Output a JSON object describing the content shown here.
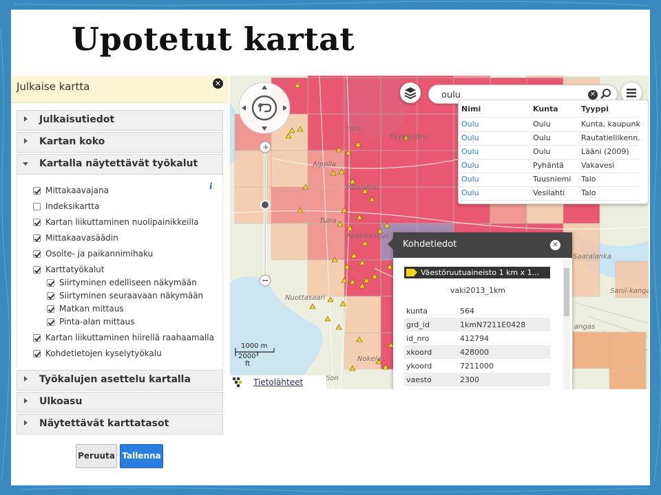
{
  "slide": {
    "title": "Upotetut kartat"
  },
  "panel": {
    "title": "Julkaise kartta",
    "sections": {
      "publication": "Julkaisutiedot",
      "map_size": "Kartan koko",
      "tools": "Kartalla näytettävät työkalut",
      "tool_layout": "Työkalujen asettelu kartalla",
      "appearance": "Ulkoasu",
      "layers": "Näytettävät karttatasot"
    },
    "tools": [
      {
        "label": "Mittakaavajana",
        "checked": true
      },
      {
        "label": "Indeksikartta",
        "checked": false
      },
      {
        "label": "Kartan liikuttaminen nuolipainikkeilla",
        "checked": true
      },
      {
        "label": "Mittakaavasäädin",
        "checked": true
      },
      {
        "label": "Osoite- ja paikannimihaku",
        "checked": true
      },
      {
        "label": "Karttatyökalut",
        "checked": true
      },
      {
        "label": "Siirtyminen edelliseen näkymään",
        "checked": true
      },
      {
        "label": "Siirtyminen seuraavaan näkymään",
        "checked": true
      },
      {
        "label": "Matkan mittaus",
        "checked": true
      },
      {
        "label": "Pinta-alan mittaus",
        "checked": true
      },
      {
        "label": "Kartan liikuttaminen hiirellä raahaamalla",
        "checked": true
      },
      {
        "label": "Kohdetietojen kyselytyökalu",
        "checked": true
      }
    ],
    "info_icon": "i",
    "cancel": "Peruuta",
    "save": "Tallenna"
  },
  "search": {
    "value": "oulu",
    "clear_icon": "close-icon",
    "search_icon": "search-icon"
  },
  "results": {
    "headers": [
      "Nimi",
      "Kunta",
      "Tyyppi"
    ],
    "rows": [
      [
        "Oulu",
        "Oulu",
        "Kunta, kaupunki"
      ],
      [
        "Oulu",
        "Oulu",
        "Rautatieliikenn..."
      ],
      [
        "Oulu",
        "Oulu",
        "Lääni (2009)"
      ],
      [
        "Oulu",
        "Pyhäntä",
        "Vakavesi"
      ],
      [
        "Oulu",
        "Tuusniemi",
        "Talo"
      ],
      [
        "Oulu",
        "Vesilahti",
        "Talo"
      ]
    ]
  },
  "info": {
    "title": "Kohdetiedot",
    "layer": "Väestöruutuaineisto 1 km x 1...",
    "subtitle": "vaki2013_1km",
    "rows": [
      [
        "kunta",
        "564"
      ],
      [
        "grd_id",
        "1kmN7211E0428"
      ],
      [
        "id_nro",
        "412794"
      ],
      [
        "xkoord",
        "428000"
      ],
      [
        "ykoord",
        "7211000"
      ],
      [
        "vaesto",
        "2300"
      ]
    ]
  },
  "map": {
    "scale_metric": "1000 m",
    "scale_imperial_value": "2000",
    "scale_imperial_unit": "ft",
    "attribution": "Tietolähteet",
    "place_labels": [
      "Isko",
      "Pyykösjärvi",
      "Alppila",
      "Välivainio",
      "Tuira",
      "Koskikeskus",
      "Nuottasaari",
      "Nokela",
      "maraution",
      "Saaralanka",
      "Sanii-kangas",
      "angas"
    ],
    "colors": {
      "high": "#e8405f",
      "mid": "#f08a86",
      "low": "#f7c4a2",
      "dense": "#9d7aa8",
      "marker": "#f1d320"
    }
  }
}
